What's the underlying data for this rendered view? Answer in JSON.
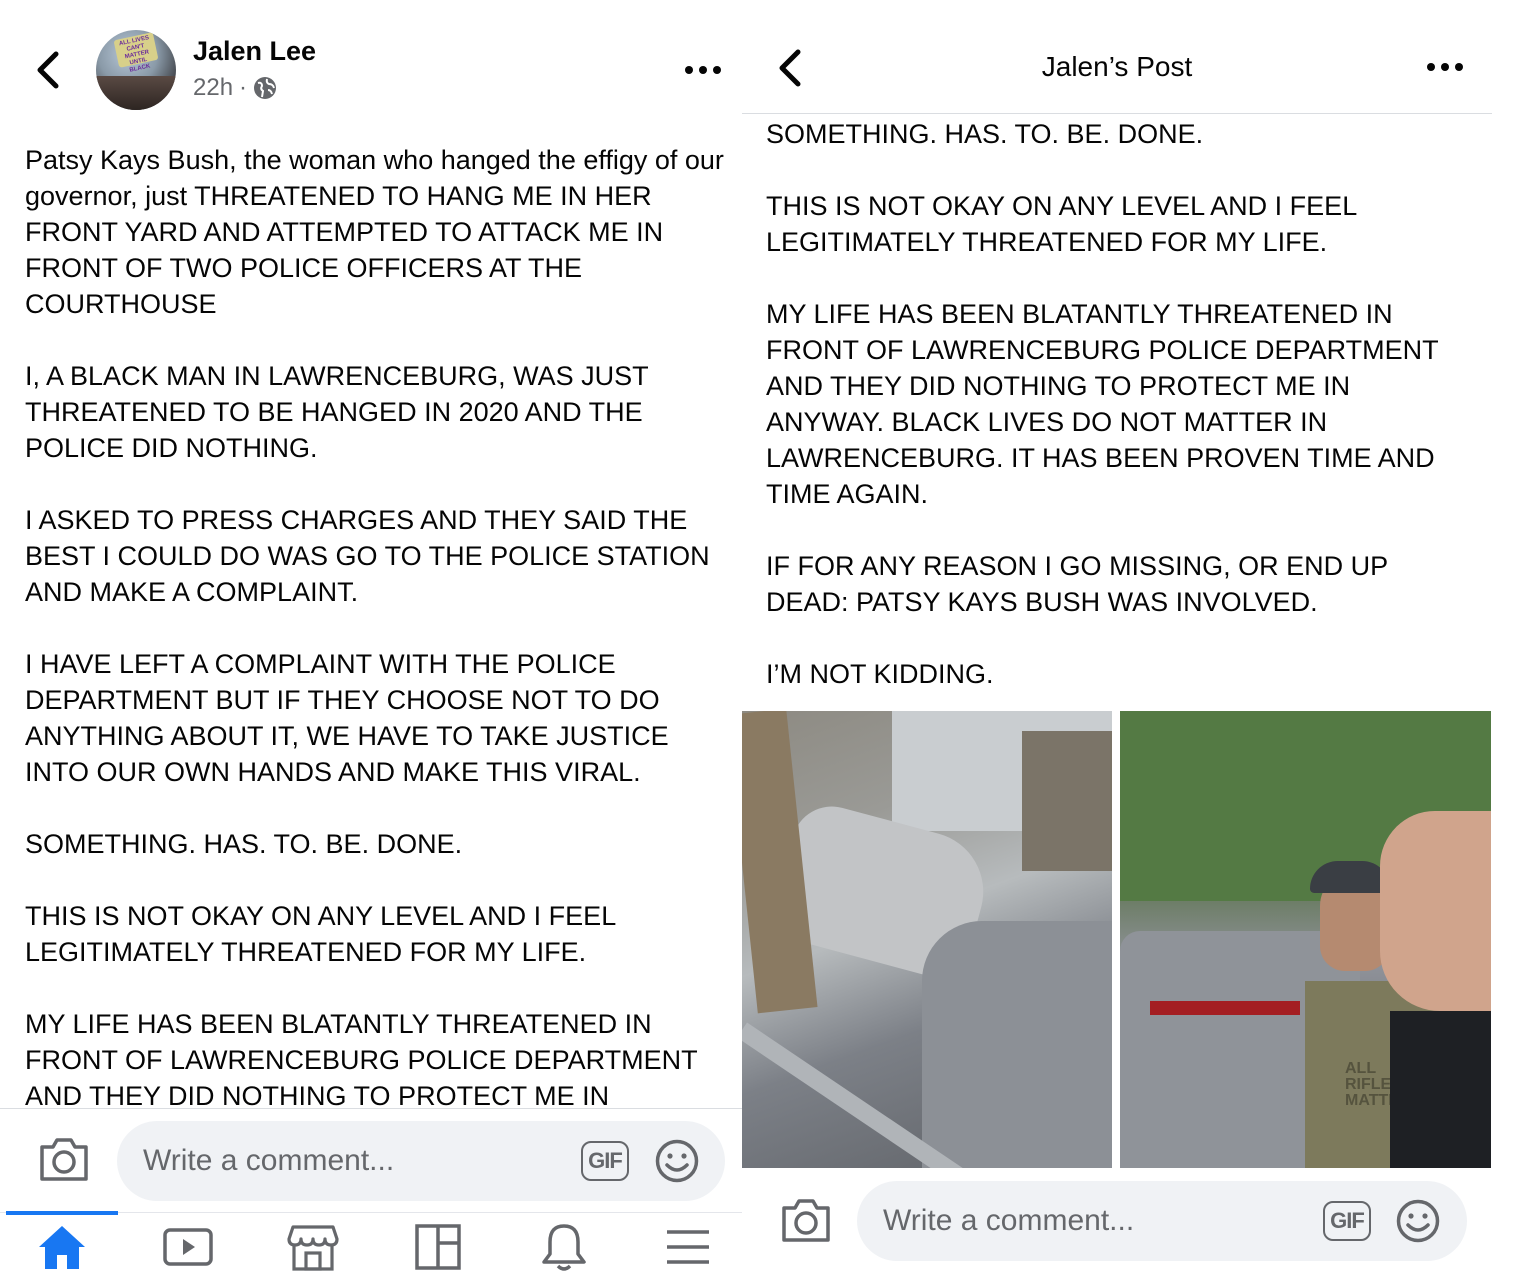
{
  "left": {
    "author": "Jalen Lee",
    "time": "22h",
    "separator": "·",
    "avatar_sign_text": "ALL LIVES CAN'T MATTER UNTIL BLACK LIVES DO",
    "post_text": "Patsy Kays Bush, the woman who hanged the effigy of our governor, just THREATENED TO HANG ME IN HER FRONT YARD AND ATTEMPTED TO ATTACK ME IN FRONT OF TWO POLICE OFFICERS AT THE COURTHOUSE\n\nI, A BLACK MAN IN LAWRENCEBURG, WAS JUST THREATENED TO BE HANGED IN 2020 AND THE POLICE DID NOTHING.\n\nI ASKED TO PRESS CHARGES AND THEY SAID THE BEST I COULD DO WAS GO TO THE POLICE STATION AND MAKE A COMPLAINT.\n\nI HAVE LEFT A COMPLAINT WITH THE POLICE DEPARTMENT BUT IF THEY CHOOSE NOT TO DO ANYTHING ABOUT IT, WE HAVE TO TAKE JUSTICE INTO OUR OWN HANDS AND MAKE THIS VIRAL.\n\nSOMETHING. HAS. TO. BE. DONE.\n\nTHIS IS NOT OKAY ON ANY LEVEL AND I FEEL LEGITIMATELY THREATENED FOR MY LIFE.\n\nMY LIFE HAS BEEN BLATANTLY THREATENED IN FRONT OF LAWRENCEBURG POLICE DEPARTMENT AND THEY DID NOTHING TO PROTECT ME IN",
    "comment_placeholder": "Write a comment...",
    "gif_label": "GIF",
    "nav": [
      {
        "name": "home",
        "icon": "home-icon",
        "active": true
      },
      {
        "name": "watch",
        "icon": "video-icon",
        "active": false
      },
      {
        "name": "marketplace",
        "icon": "marketplace-icon",
        "active": false
      },
      {
        "name": "pages",
        "icon": "pages-icon",
        "active": false
      },
      {
        "name": "notifications",
        "icon": "bell-icon",
        "active": false
      },
      {
        "name": "menu",
        "icon": "hamburger-menu-icon",
        "active": false
      }
    ],
    "accent_color": "#1877f2"
  },
  "right": {
    "title": "Jalen’s Post",
    "post_text": "SOMETHING. HAS. TO. BE. DONE.\n\nTHIS IS NOT OKAY ON ANY LEVEL AND I FEEL LEGITIMATELY THREATENED FOR MY LIFE.\n\nMY LIFE HAS BEEN BLATANTLY THREATENED IN FRONT OF LAWRENCEBURG POLICE DEPARTMENT AND THEY DID NOTHING TO PROTECT ME IN ANYWAY. BLACK LIVES DO NOT MATTER IN LAWRENCEBURG. IT HAS BEEN PROVEN TIME AND TIME AGAIN.\n\nIF FOR ANY REASON I GO MISSING, OR END UP DEAD: PATSY KAYS BUSH WAS INVOLVED.\n\nI’M NOT KIDDING.",
    "photo_shirt_text": "ALL RIFLES MATTER",
    "comment_placeholder": "Write a comment...",
    "gif_label": "GIF"
  }
}
